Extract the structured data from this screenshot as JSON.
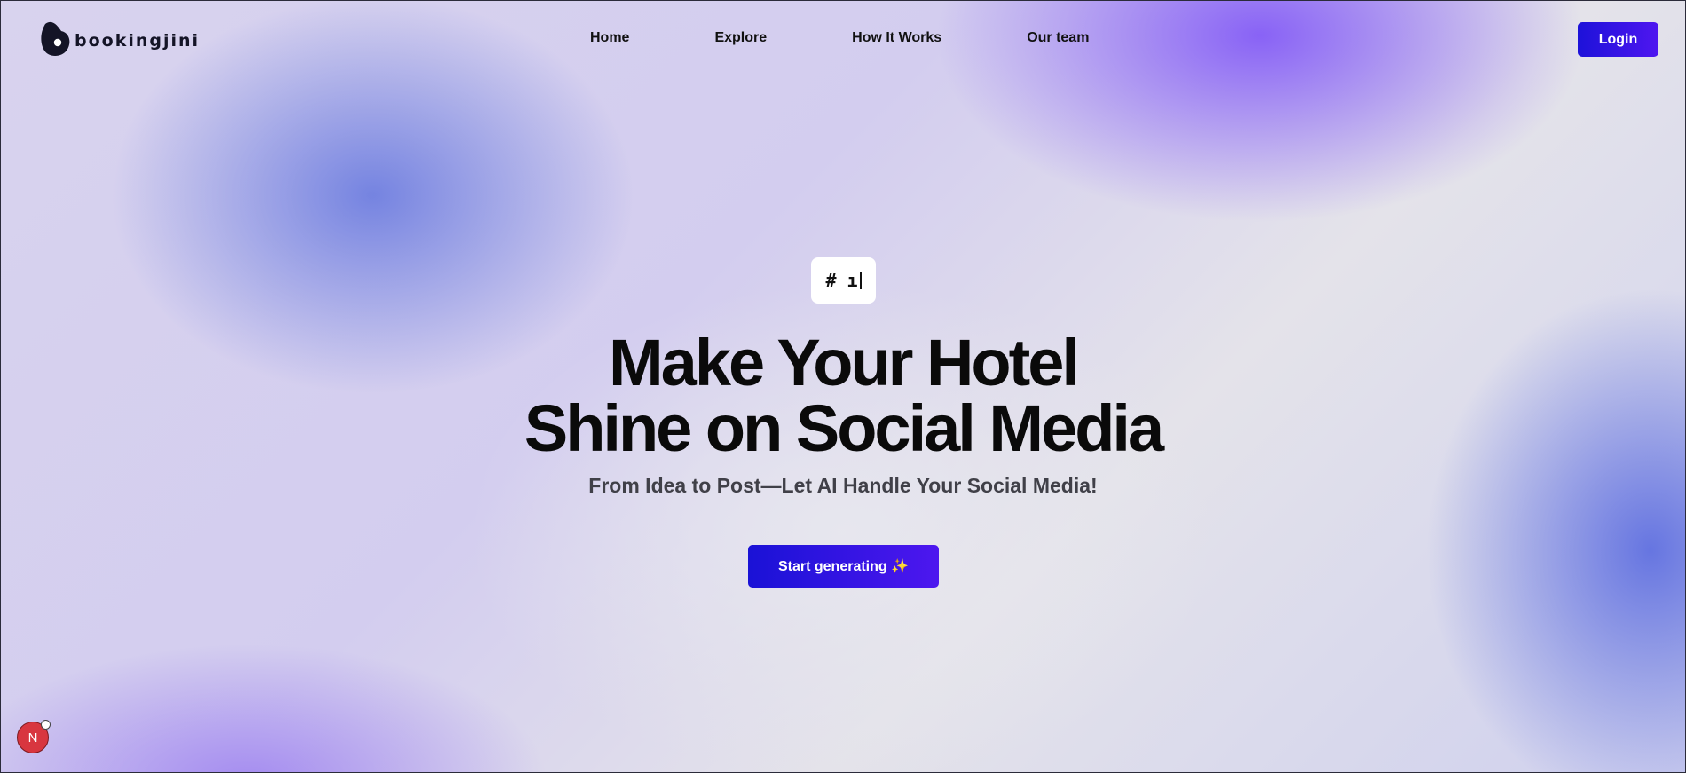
{
  "brand": {
    "name": "bookingjini",
    "logo_color": "#141426"
  },
  "nav": {
    "items": [
      {
        "label": "Home"
      },
      {
        "label": "Explore"
      },
      {
        "label": "How It Works"
      },
      {
        "label": "Our team"
      }
    ]
  },
  "header": {
    "login_label": "Login"
  },
  "hero": {
    "badge_text": "# ı",
    "headline_line1": "Make Your Hotel",
    "headline_line2": "Shine on Social Media",
    "subtitle": "From Idea to Post—Let AI Handle Your Social Media!",
    "cta_label": "Start generating ✨"
  },
  "dev_indicator": {
    "label": "N"
  },
  "colors": {
    "accent": "#1d12d9",
    "accent_end": "#4f16f0",
    "dev_badge": "#d8363f"
  }
}
